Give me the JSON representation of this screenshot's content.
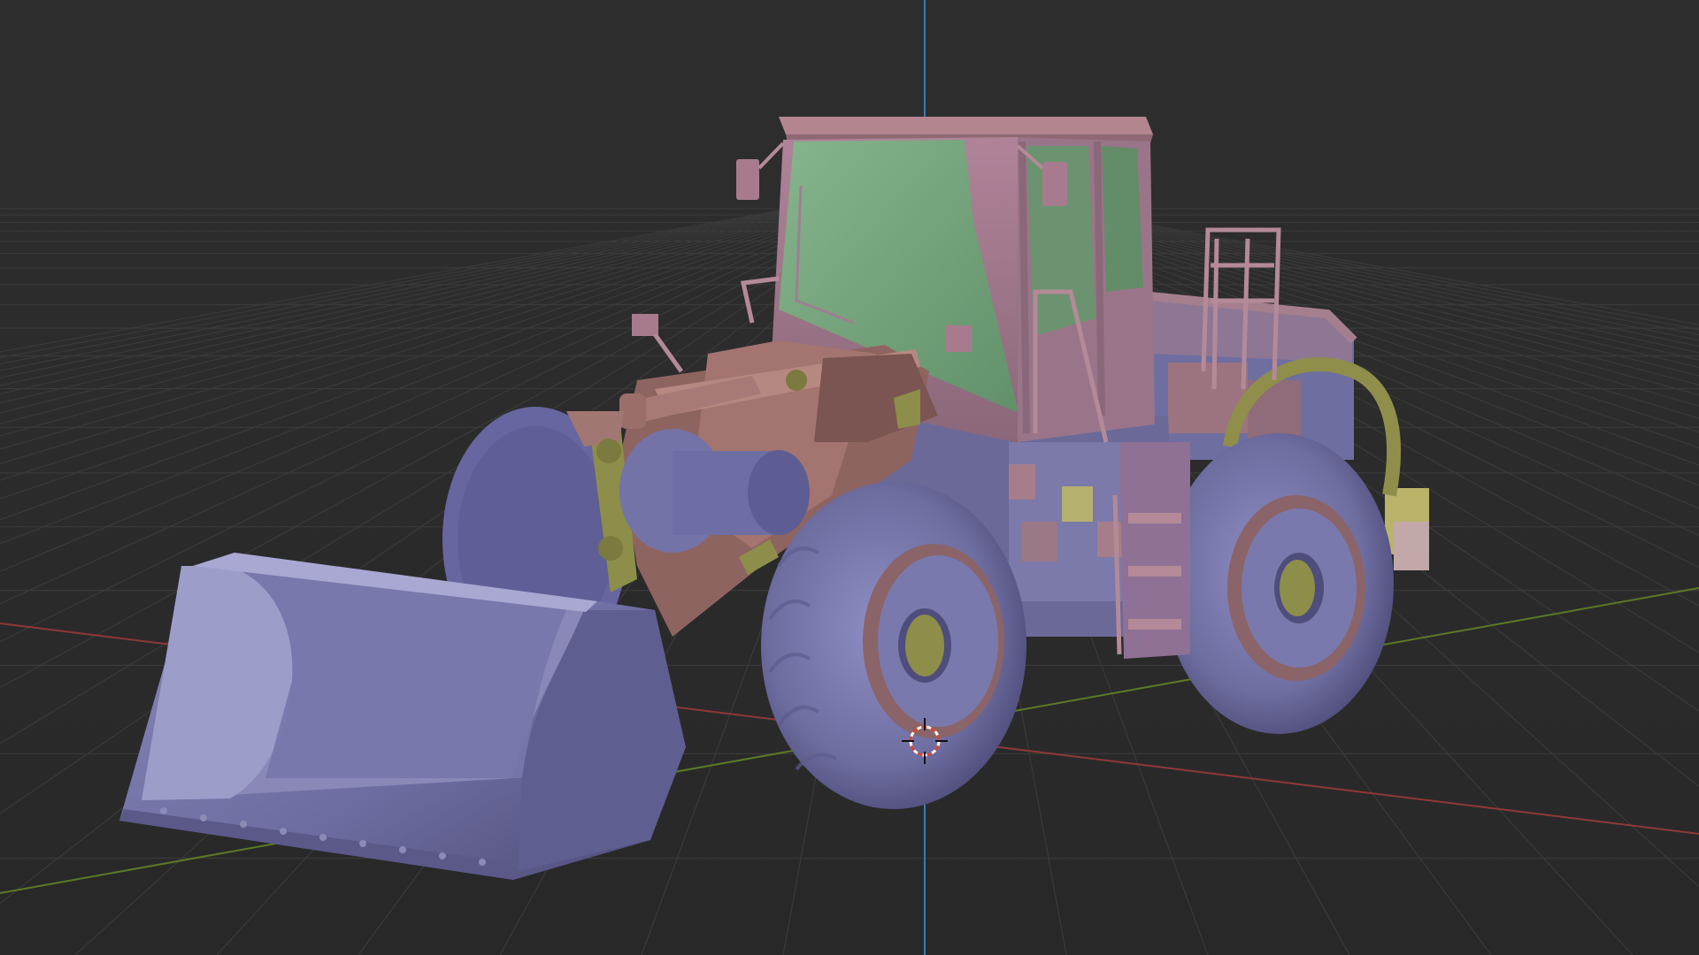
{
  "viewport": {
    "background": "#2b2b2b",
    "grid_color": "#3a3a3a",
    "x_axis_color": "#9a3b3b",
    "y_axis_color": "#6a8a2a",
    "z_axis_color": "#3a7ab0"
  },
  "scene": {
    "object": "wheel-loader",
    "palette": {
      "body_pink": "#a5788d",
      "body_dark": "#7d5a6a",
      "glass_green": "#78a57f",
      "metal_blue": "#7b7aaa",
      "metal_blue_dark": "#58578a",
      "rust": "#8e6460",
      "olive": "#8d8e4a",
      "cursor_red": "#d04a3a"
    }
  }
}
